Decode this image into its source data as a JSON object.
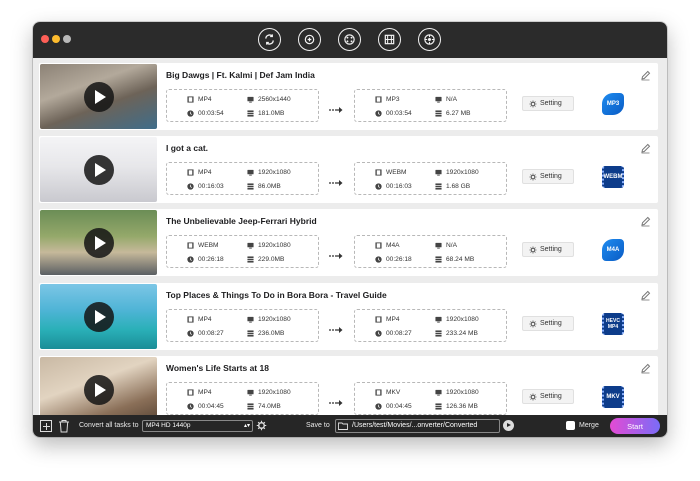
{
  "toolbar": {
    "icons": [
      "convert-icon",
      "compress-icon",
      "dvd-icon",
      "toolbox-icon",
      "burn-icon"
    ]
  },
  "tasks": [
    {
      "title": "Big Dawgs | Ft. Kalmi | Def Jam India",
      "source": {
        "format": "MP4",
        "resolution": "2560x1440",
        "duration": "00:03:54",
        "size": "181.0MB"
      },
      "target": {
        "format": "MP3",
        "resolution": "N/A",
        "duration": "00:03:54",
        "size": "6.27 MB"
      },
      "setting_label": "Setting",
      "format_badge": "MP3",
      "badge_kind": "audio"
    },
    {
      "title": "I got a cat.",
      "source": {
        "format": "MP4",
        "resolution": "1920x1080",
        "duration": "00:16:03",
        "size": "86.0MB"
      },
      "target": {
        "format": "WEBM",
        "resolution": "1920x1080",
        "duration": "00:16:03",
        "size": "1.68 GB"
      },
      "setting_label": "Setting",
      "format_badge": "WEBM",
      "badge_kind": "video"
    },
    {
      "title": "The Unbelievable Jeep-Ferrari Hybrid",
      "source": {
        "format": "WEBM",
        "resolution": "1920x1080",
        "duration": "00:26:18",
        "size": "229.0MB"
      },
      "target": {
        "format": "M4A",
        "resolution": "N/A",
        "duration": "00:26:18",
        "size": "68.24 MB"
      },
      "setting_label": "Setting",
      "format_badge": "M4A",
      "badge_kind": "audio"
    },
    {
      "title": "Top Places & Things To Do in Bora Bora - Travel Guide",
      "source": {
        "format": "MP4",
        "resolution": "1920x1080",
        "duration": "00:08:27",
        "size": "236.0MB"
      },
      "target": {
        "format": "MP4",
        "resolution": "1920x1080",
        "duration": "00:08:27",
        "size": "233.24 MB"
      },
      "setting_label": "Setting",
      "format_badge": "HEVC MP4",
      "badge_kind": "hevc"
    },
    {
      "title": "Women's Life Starts at 18",
      "source": {
        "format": "MP4",
        "resolution": "1920x1080",
        "duration": "00:04:45",
        "size": "74.0MB"
      },
      "target": {
        "format": "MKV",
        "resolution": "1920x1080",
        "duration": "00:04:45",
        "size": "126.36 MB"
      },
      "setting_label": "Setting",
      "format_badge": "MKV",
      "badge_kind": "video"
    }
  ],
  "bottom": {
    "convert_all_label": "Convert all tasks to",
    "convert_all_value": "MP4 HD 1440p",
    "save_to_label": "Save to",
    "save_path": "/Users/test/Movies/...onverter/Converted",
    "merge_label": "Merge",
    "start_label": "Start"
  },
  "colors": {
    "titlebar": "#2b2b2b",
    "bottombar": "#262626",
    "start_gradient_from": "#e34bd4",
    "start_gradient_to": "#7a6cf7"
  }
}
